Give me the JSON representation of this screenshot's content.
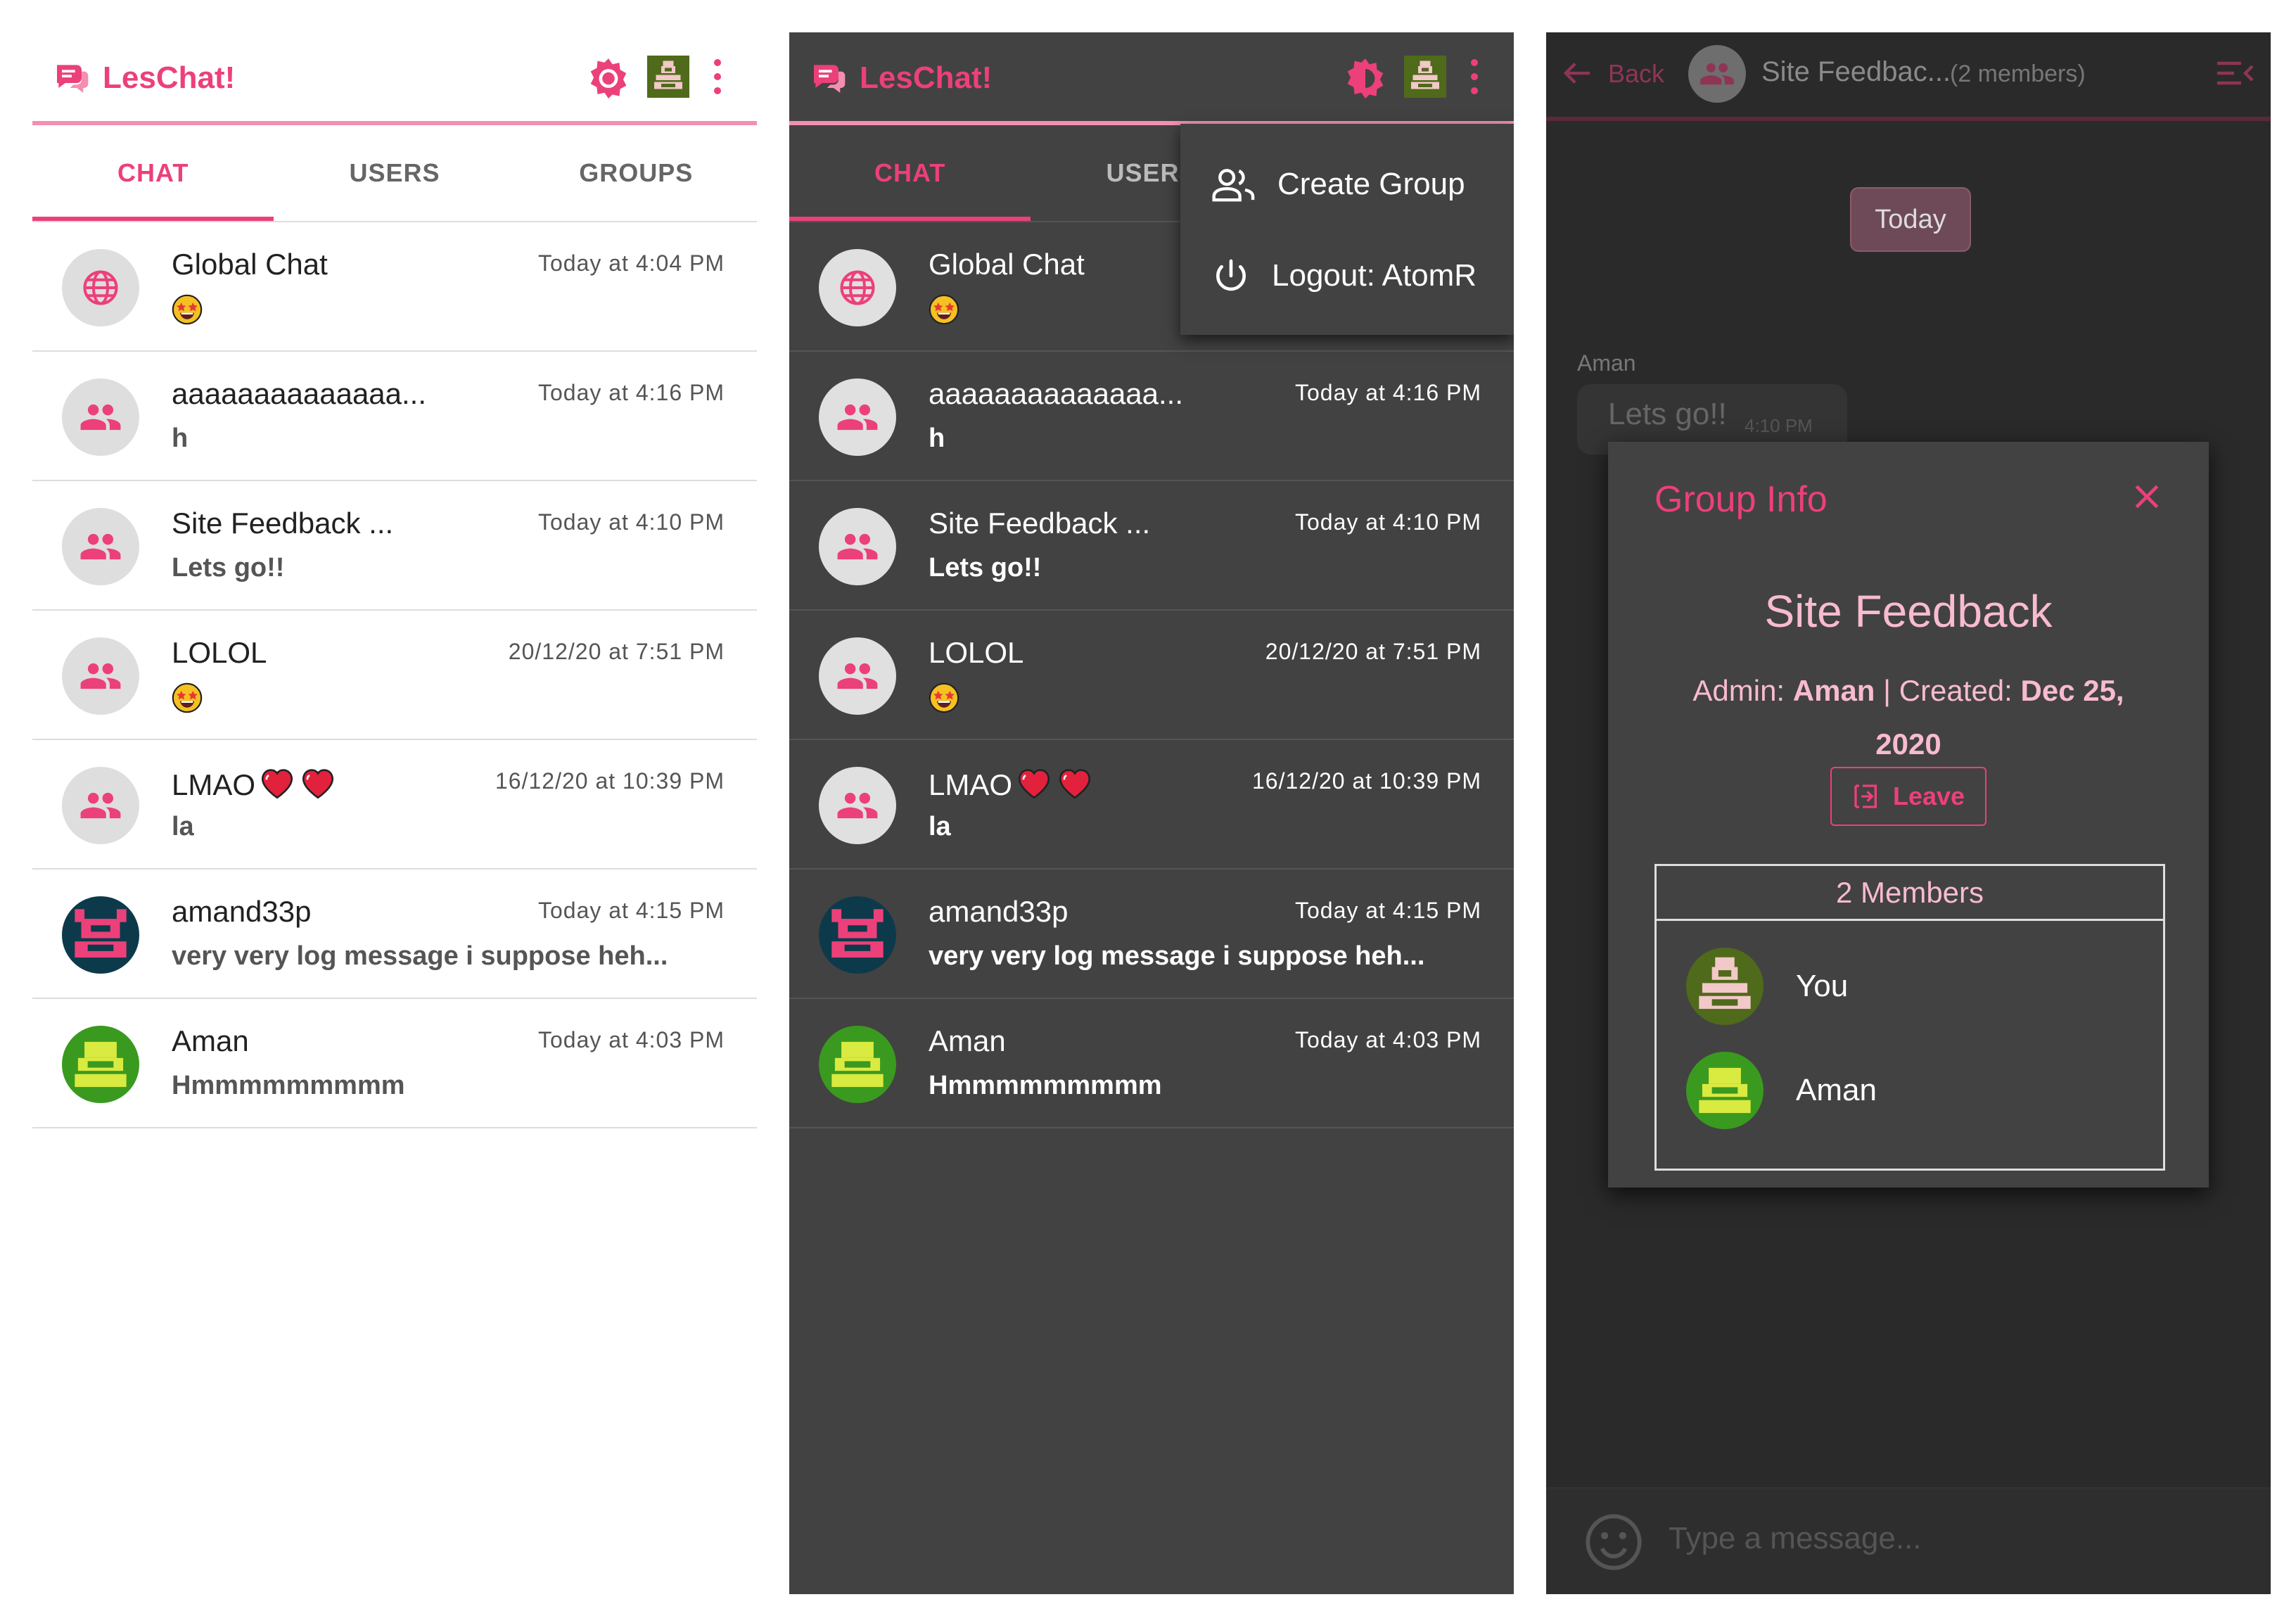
{
  "app": {
    "title": "LesChat!"
  },
  "colors": {
    "accent": "#ec407a",
    "accent_light": "#f8bbd0",
    "dark_bg": "#424242",
    "darker_bg": "#2a2a2a"
  },
  "tabs": [
    {
      "label": "CHAT",
      "active": true
    },
    {
      "label": "USERS",
      "active": false
    },
    {
      "label": "GROUPS",
      "active": false
    }
  ],
  "chats": [
    {
      "name": "Global Chat",
      "time": "Today at 4:04 PM",
      "preview": "",
      "preview_emoji": "star-struck-emoji",
      "avatar": "globe-icon"
    },
    {
      "name": "aaaaaaaaaaaaaa...",
      "time": "Today at 4:16 PM",
      "preview": "h",
      "avatar": "group-icon"
    },
    {
      "name": "Site Feedback ...",
      "time": "Today at 4:10 PM",
      "preview": "Lets go!!",
      "avatar": "group-icon"
    },
    {
      "name": "LOLOL",
      "time": "20/12/20 at 7:51 PM",
      "preview": "",
      "preview_emoji": "star-struck-emoji",
      "avatar": "group-icon"
    },
    {
      "name": "LMAO",
      "time": "16/12/20 at 10:39 PM",
      "preview": "la",
      "avatar": "group-icon",
      "name_emoji": "heart-emoji"
    },
    {
      "name": "amand33p",
      "time": "Today at 4:15 PM",
      "preview": "very very log message i suppose heh...",
      "avatar": "pixel-avatar-pink"
    },
    {
      "name": "Aman",
      "time": "Today at 4:03 PM",
      "preview": "Hmmmmmmmmm",
      "avatar": "pixel-avatar-green"
    }
  ],
  "panel2_tabs": [
    {
      "label": "CHAT"
    },
    {
      "label": "USERS"
    }
  ],
  "menu": {
    "create_group": "Create Group",
    "logout": "Logout: AtomR"
  },
  "conversation": {
    "back_label": "Back",
    "title": "Site Feedbac...",
    "members_count": "(2 members)",
    "date_chip": "Today",
    "sender": "Aman",
    "message": "Lets go!!",
    "message_time": "4:10 PM",
    "composer_placeholder": "Type a message..."
  },
  "group_info": {
    "title": "Group Info",
    "group_name": "Site Feedback",
    "admin_label": "Admin:",
    "admin_name": "Aman",
    "separator": "|",
    "created_label": "Created:",
    "created_date_1": "Dec 25,",
    "created_date_2": "2020",
    "leave_label": "Leave",
    "members_header": "2 Members",
    "members": [
      {
        "name": "You",
        "avatar": "pixel-avatar-olive"
      },
      {
        "name": "Aman",
        "avatar": "pixel-avatar-green"
      }
    ]
  }
}
